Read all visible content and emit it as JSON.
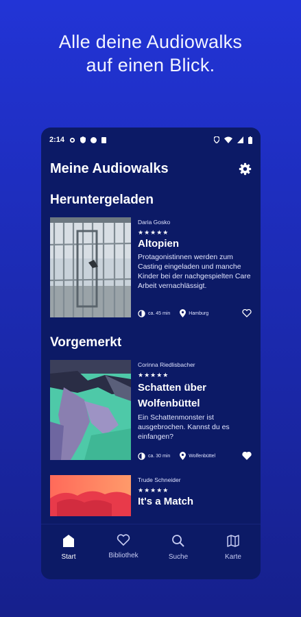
{
  "promo": {
    "line1": "Alle deine Audiowalks",
    "line2": "auf einen Blick."
  },
  "statusbar": {
    "time": "2:14"
  },
  "app": {
    "title": "Meine Audiowalks",
    "settings_icon": "gear-icon"
  },
  "sections": {
    "downloaded": "Heruntergeladen",
    "bookmarked": "Vorgemerkt"
  },
  "walks": [
    {
      "author": "Daria Gosko",
      "stars": "★★★★★",
      "title": "Altopien",
      "description": "Protagonistinnen werden zum Casting eingeladen und manche Kinder bei der nachgespielten Care Arbeit vernachlässigt.",
      "duration": "ca. 45 min",
      "location": "Hamburg",
      "favorite": false
    },
    {
      "author": "Corinna Riedlisbacher",
      "stars": "★★★★★",
      "title": "Schatten über Wolfenbüttel",
      "description": "Ein Schattenmonster ist ausgebrochen. Kannst du es einfangen?",
      "duration": "ca. 30 min",
      "location": "Wolfenbüttel",
      "favorite": true
    },
    {
      "author": "Trude Schneider",
      "stars": "★★★★★",
      "title": "It's a Match"
    }
  ],
  "nav": [
    {
      "label": "Start",
      "icon": "home-icon",
      "active": true
    },
    {
      "label": "Bibliothek",
      "icon": "heart-icon",
      "active": false
    },
    {
      "label": "Suche",
      "icon": "search-icon",
      "active": false
    },
    {
      "label": "Karte",
      "icon": "map-icon",
      "active": false
    }
  ]
}
